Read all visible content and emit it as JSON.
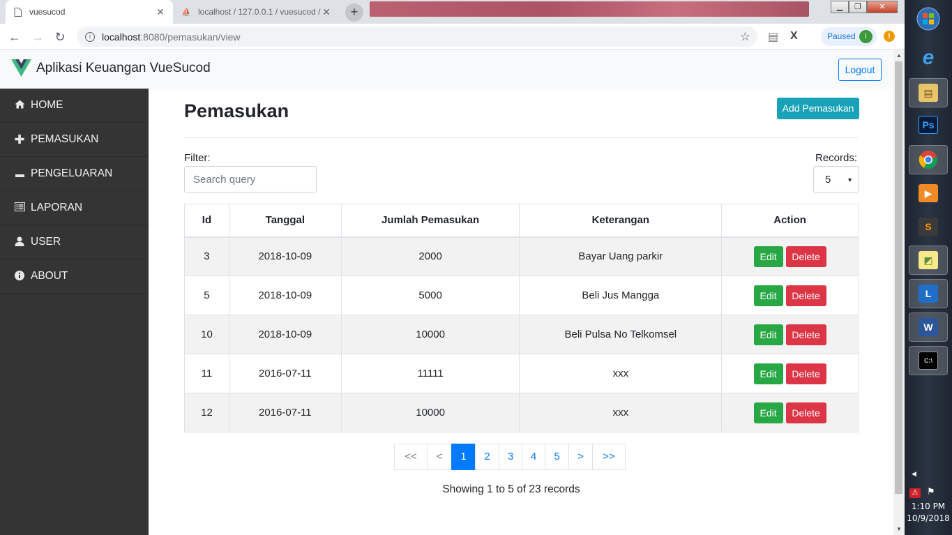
{
  "browser": {
    "tabs": [
      {
        "title": "vuesucod",
        "active": true
      },
      {
        "title": "localhost / 127.0.0.1 / vuesucod /",
        "active": false
      }
    ],
    "url_host": "localhost",
    "url_path": ":8080/pemasukan/view",
    "profile_status": "Paused",
    "profile_initial": "i"
  },
  "navbar": {
    "brand": "Aplikasi Keuangan VueSucod",
    "logout_label": "Logout"
  },
  "sidebar": {
    "items": [
      {
        "label": "HOME",
        "icon": "home-icon"
      },
      {
        "label": "PEMASUKAN",
        "icon": "plus-icon"
      },
      {
        "label": "PENGELUARAN",
        "icon": "minus-icon"
      },
      {
        "label": "LAPORAN",
        "icon": "list-icon"
      },
      {
        "label": "USER",
        "icon": "user-icon"
      },
      {
        "label": "ABOUT",
        "icon": "info-icon"
      }
    ]
  },
  "main": {
    "title": "Pemasukan",
    "add_button": "Add Pemasukan",
    "filter_label": "Filter:",
    "search_placeholder": "Search query",
    "records_label": "Records:",
    "records_value": "5"
  },
  "table": {
    "headers": [
      "Id",
      "Tanggal",
      "Jumlah Pemasukan",
      "Keterangan",
      "Action"
    ],
    "rows": [
      {
        "id": "3",
        "tanggal": "2018-10-09",
        "jumlah": "2000",
        "keterangan": "Bayar Uang parkir"
      },
      {
        "id": "5",
        "tanggal": "2018-10-09",
        "jumlah": "5000",
        "keterangan": "Beli Jus Mangga"
      },
      {
        "id": "10",
        "tanggal": "2018-10-09",
        "jumlah": "10000",
        "keterangan": "Beli Pulsa No Telkomsel"
      },
      {
        "id": "11",
        "tanggal": "2016-07-11",
        "jumlah": "11111",
        "keterangan": "xxx"
      },
      {
        "id": "12",
        "tanggal": "2016-07-11",
        "jumlah": "10000",
        "keterangan": "xxx"
      }
    ],
    "edit_label": "Edit",
    "delete_label": "Delete"
  },
  "pagination": {
    "first": "<<",
    "prev": "<",
    "pages": [
      "1",
      "2",
      "3",
      "4",
      "5"
    ],
    "active_page": "1",
    "next": ">",
    "last": ">>",
    "summary": "Showing 1 to 5 of 23 records"
  },
  "taskbar": {
    "time": "1:10 PM",
    "date": "10/9/2018"
  },
  "colors": {
    "sidebar_bg": "#343434",
    "primary": "#007bff",
    "info": "#17a2b8",
    "success": "#28a745",
    "danger": "#dc3545"
  }
}
